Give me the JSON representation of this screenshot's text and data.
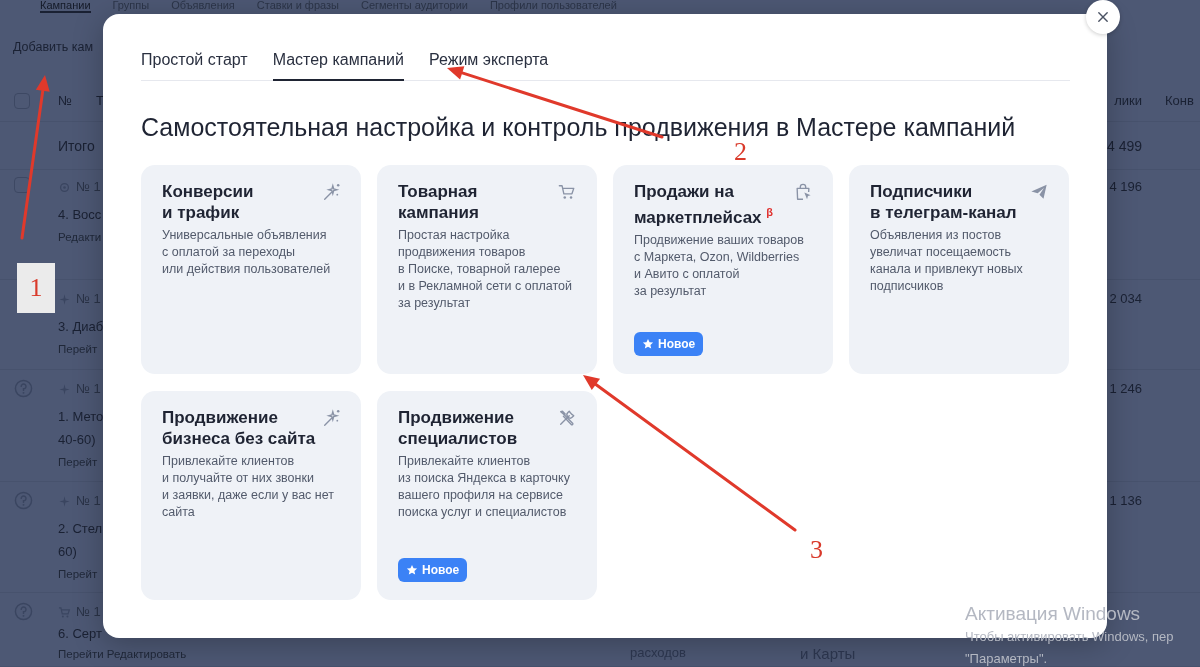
{
  "background": {
    "tabs": [
      {
        "label": "Кампании",
        "selected": true
      },
      {
        "label": "Группы",
        "selected": false
      },
      {
        "label": "Объявления",
        "selected": false
      },
      {
        "label": "Ставки и фразы",
        "selected": false
      },
      {
        "label": "Сегменты аудитории",
        "selected": false
      },
      {
        "label": "Профили пользователей",
        "selected": false
      }
    ],
    "add_button": "Добавить кам",
    "header": {
      "checked": false,
      "columns_left": [
        "№",
        "Т"
      ],
      "columns_right": [
        "лики",
        "Конв"
      ]
    },
    "total": {
      "label": "Итого",
      "clicks": "4 499"
    },
    "rows": [
      {
        "kind": "smart",
        "checked": false,
        "number": "№ 1",
        "name_lines": [
          "4. Восс"
        ],
        "action": "Редакти",
        "clicks": "4 196"
      },
      {
        "kind": "auto",
        "number": "№ 1",
        "name_lines": [
          "3. Диаб"
        ],
        "action": "Перейт",
        "clicks": "2 034"
      },
      {
        "kind": "auto",
        "help": true,
        "number": "№ 1",
        "name_lines": [
          "1. Мето",
          "40-60)"
        ],
        "action": "Перейт",
        "clicks": "1 246"
      },
      {
        "kind": "auto",
        "help": true,
        "number": "№ 1",
        "name_lines": [
          "2. Стел",
          "60)"
        ],
        "action": "Перейт",
        "clicks": "1 136"
      },
      {
        "kind": "product",
        "help": true,
        "number": "№ 1",
        "name_lines": [
          "6. Серт"
        ],
        "action": "Перейти  Редактировать"
      }
    ],
    "bottom_texts": [
      "расходов",
      "и Карты"
    ]
  },
  "modal": {
    "tabs": [
      {
        "label": "Простой старт",
        "selected": false
      },
      {
        "label": "Мастер кампаний",
        "selected": true
      },
      {
        "label": "Режим эксперта",
        "selected": false
      }
    ],
    "heading": "Самостоятельная настройка и контроль продвижения в Мастере кампаний",
    "cards": [
      {
        "kind": "wand",
        "title": "Конверсии\nи трафик",
        "description": "Универсальные объявления\nс оплатой за переходы\nили действия пользователей"
      },
      {
        "kind": "cart",
        "title": "Товарная\nкампания",
        "description": "Простая настройка\nпродвижения товаров\nв Поиске, товарной галерее\nи в Рекламной сети с оплатой\nза результат"
      },
      {
        "kind": "bag",
        "title": "Продажи на\nмаркетплейсах $^{β}$",
        "description": "Продвижение ваших товаров\nс Маркета, Ozon, Wildberries\nи Авито с оплатой\nза результат",
        "badge": "Новое"
      },
      {
        "kind": "plane",
        "title": "Подписчики\nв телеграм-канал",
        "description": "Объявления из постов\nувеличат посещаемость\nканала и привлекут новых\nподписчиков"
      },
      {
        "kind": "wand",
        "title": "Продвижение\nбизнеса без сайта",
        "description": "Привлекайте клиентов\nи получайте от них звонки\nи заявки, даже если у вас нет\nсайта"
      },
      {
        "kind": "tools",
        "title": "Продвижение\nспециалистов",
        "description": "Привлекайте клиентов\nиз поиска Яндекса в карточку\nвашего профиля на сервисе\nпоиска услуг и специалистов",
        "badge": "Новое"
      }
    ]
  },
  "annotations": [
    {
      "label": "1"
    },
    {
      "label": "2"
    },
    {
      "label": "3"
    }
  ],
  "os_notice": {
    "title": "Активация Windows",
    "lines": [
      "Чтобы активировать Windows, пер",
      "\"Параметры\"."
    ]
  }
}
